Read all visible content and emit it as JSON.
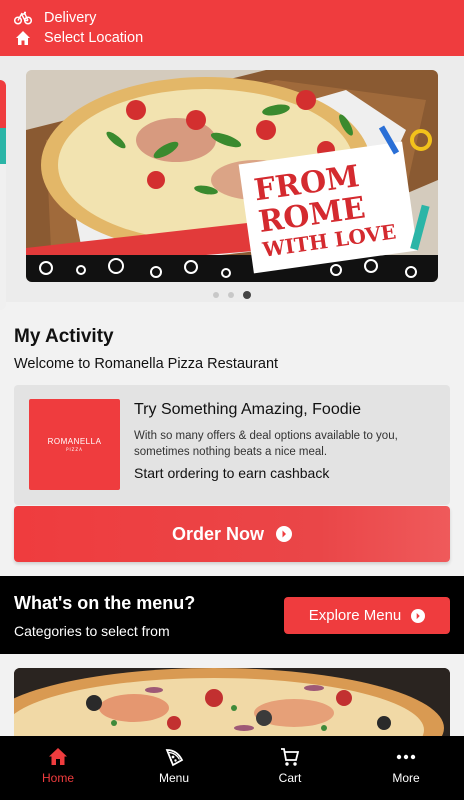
{
  "header": {
    "delivery_label": "Delivery",
    "location_label": "Select Location"
  },
  "banner": {
    "headline_line1": "FROM",
    "headline_line2": "ROME",
    "headline_line3": "WITH LOVE",
    "slide_count": 3,
    "active_slide": 3
  },
  "activity": {
    "title": "My Activity",
    "welcome": "Welcome to Romanella Pizza Restaurant",
    "card": {
      "logo_text": "ROMANELLA",
      "logo_sub": "PIZZA",
      "title": "Try Something Amazing, Foodie",
      "description": "With so many offers & deal options available to you, sometimes nothing beats a nice meal.",
      "cta": "Start ordering to earn cashback"
    },
    "order_button": "Order Now"
  },
  "menu_section": {
    "title": "What's on the menu?",
    "subtitle": "Categories to select from",
    "explore_button": "Explore Menu"
  },
  "bottom_nav": [
    {
      "label": "Home",
      "icon": "home-icon",
      "active": true
    },
    {
      "label": "Menu",
      "icon": "pizza-icon",
      "active": false
    },
    {
      "label": "Cart",
      "icon": "cart-icon",
      "active": false
    },
    {
      "label": "More",
      "icon": "more-icon",
      "active": false
    }
  ],
  "colors": {
    "brand_red": "#ef3c3e",
    "dark": "#000000",
    "card_bg": "#e3e3e3"
  }
}
